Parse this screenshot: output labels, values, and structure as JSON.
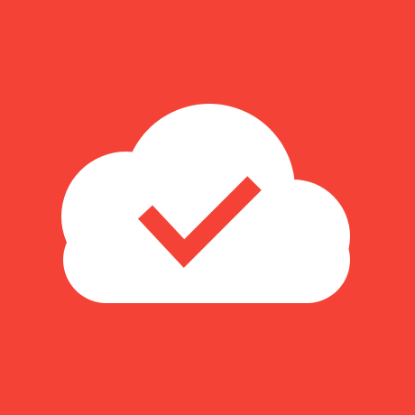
{
  "app_icon": {
    "icon_name": "cloud-check-icon",
    "colors": {
      "background": "#F44336",
      "cloud": "#FFFFFF",
      "checkmark": "#F44336"
    }
  }
}
